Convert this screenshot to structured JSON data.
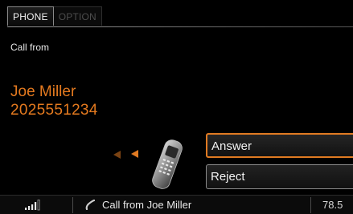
{
  "tabs": {
    "phone": "PHONE",
    "option": "OPTION"
  },
  "call": {
    "heading": "Call from",
    "name": "Joe Miller",
    "number": "2025551234"
  },
  "actions": {
    "answer": "Answer",
    "reject": "Reject"
  },
  "status": {
    "message": "Call from Joe Miller",
    "frequency": "78.5"
  },
  "icons": {
    "signal": "signal-strength-icon",
    "phone": "mobile-phone-icon",
    "handset": "handset-icon",
    "arrows": "incoming-arrow-icon"
  },
  "colors": {
    "accent": "#e07a22",
    "text": "#f2f2f2",
    "background": "#000000"
  }
}
